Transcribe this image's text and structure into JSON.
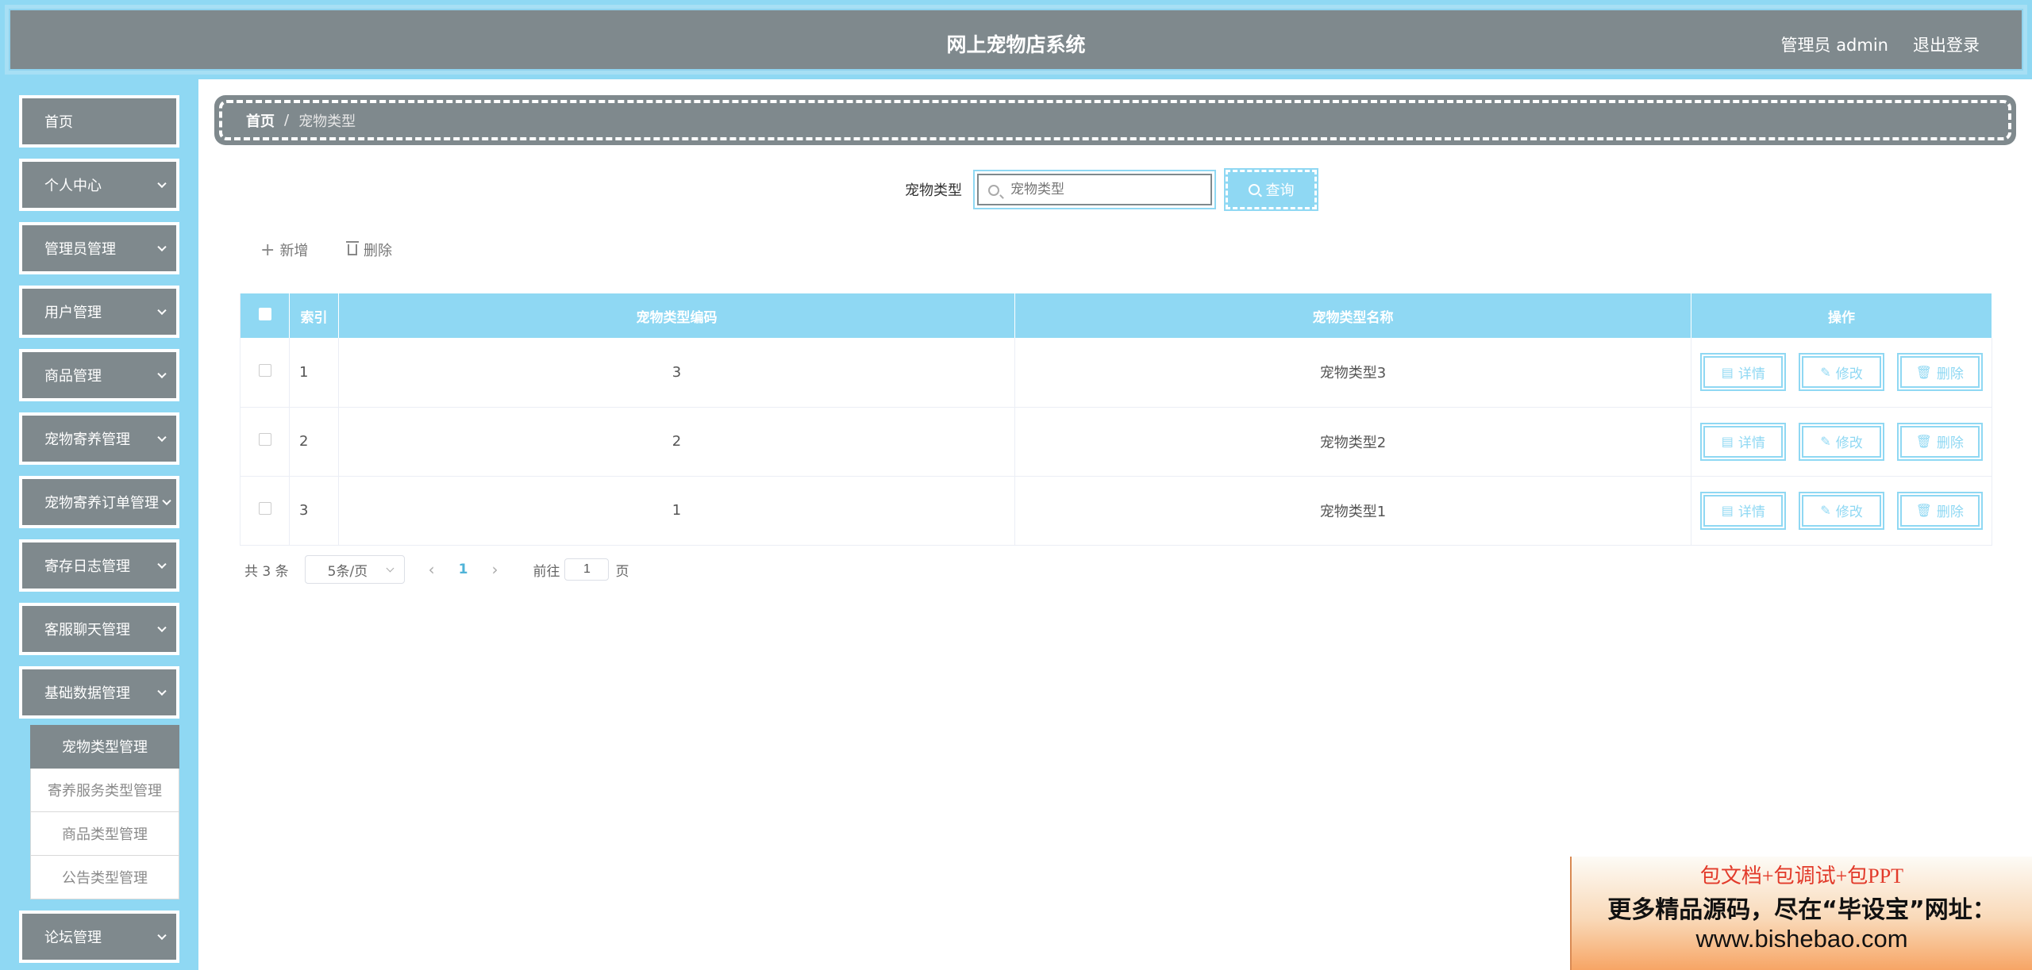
{
  "header": {
    "title": "网上宠物店系统",
    "user": "管理员 admin",
    "logout": "退出登录"
  },
  "sidebar": {
    "items": [
      {
        "label": "首页",
        "has_children": false
      },
      {
        "label": "个人中心",
        "has_children": true
      },
      {
        "label": "管理员管理",
        "has_children": true
      },
      {
        "label": "用户管理",
        "has_children": true
      },
      {
        "label": "商品管理",
        "has_children": true
      },
      {
        "label": "宠物寄养管理",
        "has_children": true
      },
      {
        "label": "宠物寄养订单管理",
        "has_children": true
      },
      {
        "label": "寄存日志管理",
        "has_children": true
      },
      {
        "label": "客服聊天管理",
        "has_children": true
      },
      {
        "label": "基础数据管理",
        "has_children": true
      },
      {
        "label": "论坛管理",
        "has_children": true
      }
    ],
    "submenu": [
      {
        "label": "宠物类型管理",
        "active": true
      },
      {
        "label": "寄养服务类型管理",
        "active": false
      },
      {
        "label": "商品类型管理",
        "active": false
      },
      {
        "label": "公告类型管理",
        "active": false
      }
    ]
  },
  "breadcrumb": {
    "home": "首页",
    "separator": "/",
    "current": "宠物类型"
  },
  "search": {
    "label": "宠物类型",
    "placeholder": "宠物类型",
    "button": "查询"
  },
  "toolbar": {
    "add": "新增",
    "delete": "删除"
  },
  "table": {
    "columns": [
      "索引",
      "宠物类型编码",
      "宠物类型名称",
      "操作"
    ],
    "rows": [
      {
        "index": "1",
        "code": "3",
        "name": "宠物类型3"
      },
      {
        "index": "2",
        "code": "2",
        "name": "宠物类型2"
      },
      {
        "index": "3",
        "code": "1",
        "name": "宠物类型1"
      }
    ],
    "actions": {
      "detail": "详情",
      "edit": "修改",
      "delete": "删除"
    }
  },
  "pagination": {
    "total": "共 3 条",
    "page_size": "5条/页",
    "current_page": "1",
    "goto_label": "前往",
    "goto_value": "1",
    "page_suffix": "页"
  },
  "banner": {
    "line1": "包文档+包调试+包PPT",
    "line2": "更多精品源码，尽在“毕设宝”网址：",
    "line3": "www.bishebao.com"
  },
  "colors": {
    "accent": "#8fd8f3",
    "header_bg": "#7f898d",
    "banner_red": "#e23a2a"
  }
}
